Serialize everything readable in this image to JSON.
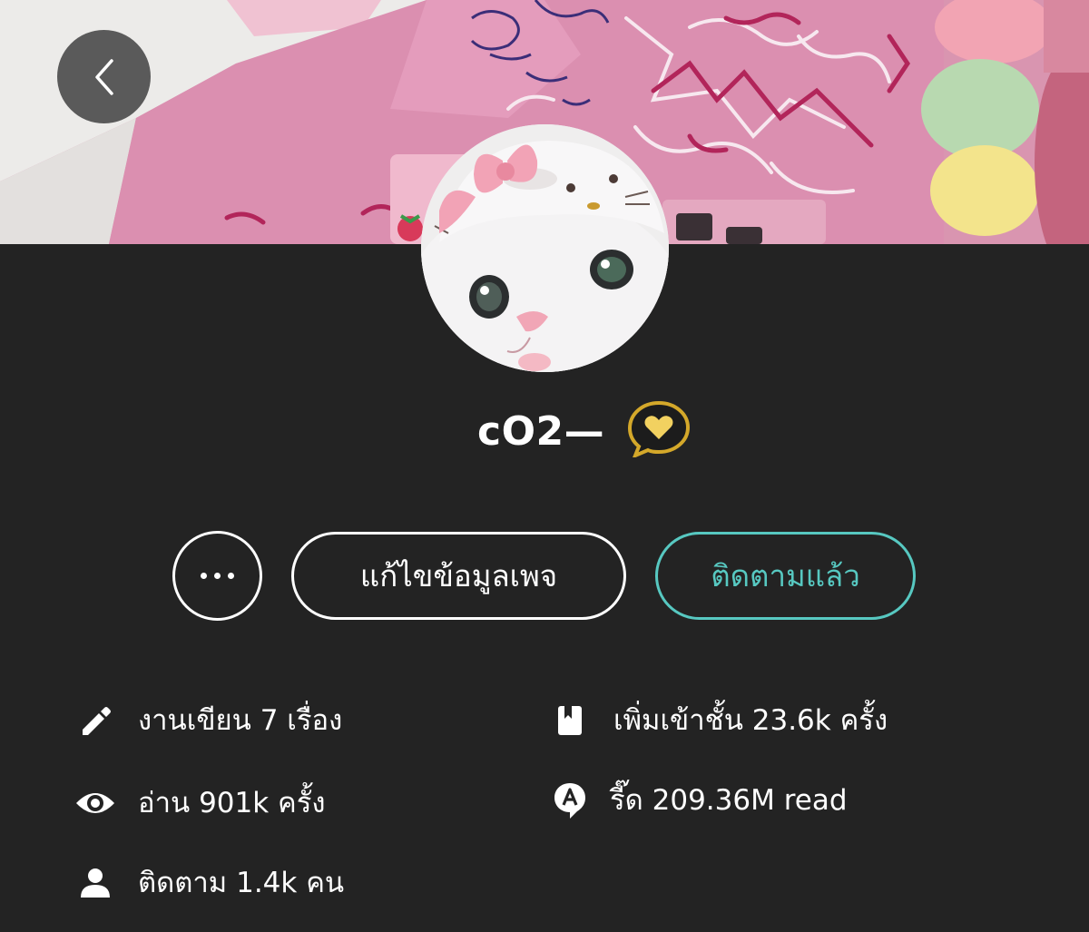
{
  "header": {
    "back_icon": "chevron-left-icon"
  },
  "profile": {
    "name": "cO2—",
    "badge_icon": "gold-heart-chat-badge-icon"
  },
  "actions": {
    "more_icon": "ellipsis-icon",
    "edit_label": "แก้ไขข้อมูลเพจ",
    "follow_label": "ติดตามแล้ว",
    "follow_color": "#57c8c1"
  },
  "stats": {
    "works": {
      "icon": "pencil-icon",
      "label": "งานเขียน 7 เรื่อง"
    },
    "library": {
      "icon": "book-icon",
      "label": "เพิ่มเข้าชั้น 23.6k ครั้ง"
    },
    "views": {
      "icon": "eye-icon",
      "label": "อ่าน 901k ครั้ง"
    },
    "reads": {
      "icon": "read-bubble-icon",
      "label": "รี๊ด 209.36M read"
    },
    "followers": {
      "icon": "person-icon",
      "label": "ติดตาม 1.4k คน"
    }
  },
  "colors": {
    "background": "#232323",
    "accent": "#57c8c1",
    "badge_gold": "#d4a82a"
  }
}
